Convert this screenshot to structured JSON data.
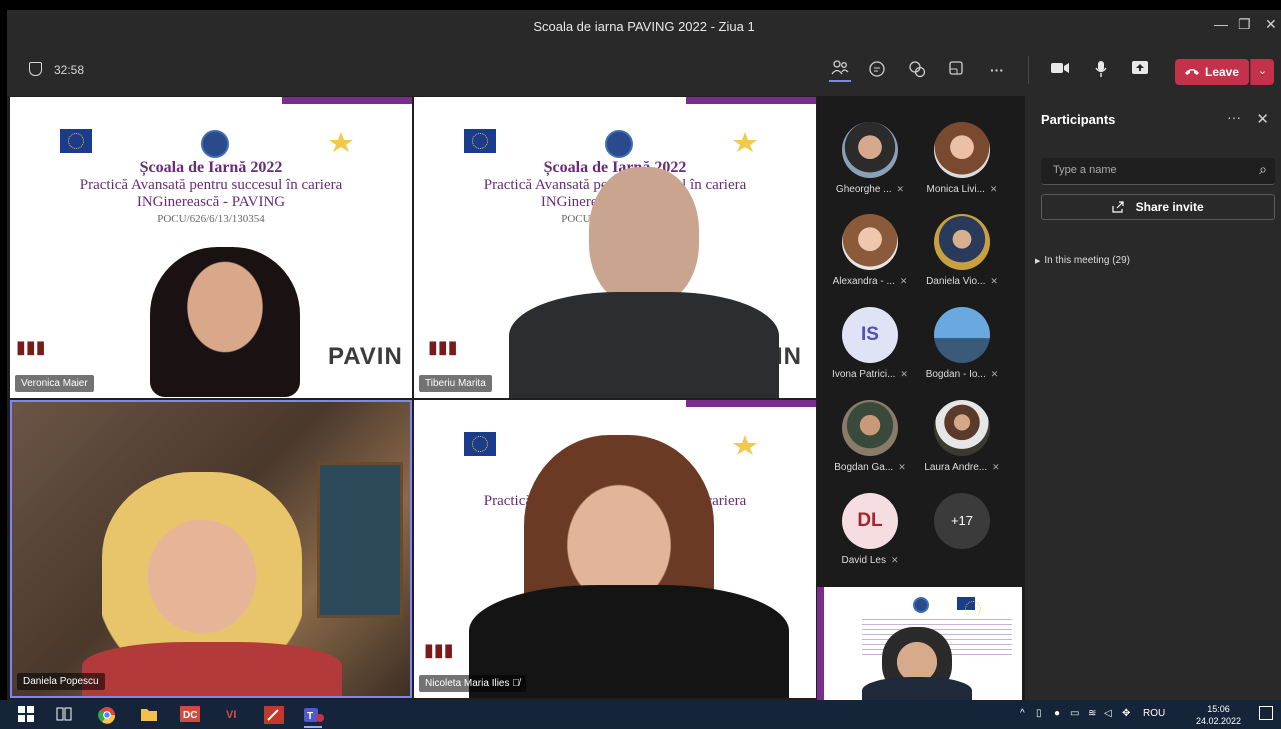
{
  "window": {
    "title": "Scoala de iarna PAVING 2022 - Ziua 1"
  },
  "toolbar": {
    "timer": "32:58",
    "leave_label": "Leave"
  },
  "slide": {
    "title": "Școala de Iarnă 2022",
    "line1": "Practică Avansată pentru succesul în cariera",
    "line2": "INGinerească - PAVING",
    "code": "POCU/626/6/13/130354",
    "paving": "PAVIN",
    "paving_cut": "VIN"
  },
  "tiles": [
    {
      "name": "Veronica Maier"
    },
    {
      "name": "Tiberiu Marita"
    },
    {
      "name": "Daniela Popescu"
    },
    {
      "name": "Nicoleta Maria Ilies"
    }
  ],
  "participants_grid": [
    {
      "name": "Gheorghe ...",
      "initials": ""
    },
    {
      "name": "Monica Livi...",
      "initials": ""
    },
    {
      "name": "Alexandra - ...",
      "initials": ""
    },
    {
      "name": "Daniela Vio...",
      "initials": ""
    },
    {
      "name": "Ivona Patrici...",
      "initials": "IS"
    },
    {
      "name": "Bogdan - Io...",
      "initials": ""
    },
    {
      "name": "Bogdan Ga...",
      "initials": ""
    },
    {
      "name": "Laura Andre...",
      "initials": ""
    },
    {
      "name": "David Les",
      "initials": "DL"
    }
  ],
  "overflow_count": "+17",
  "panel": {
    "title": "Participants",
    "search_placeholder": "Type a name",
    "share_invite": "Share invite",
    "meeting_section": "In this meeting (29)"
  },
  "taskbar": {
    "lang": "ROU",
    "time": "15:06",
    "date": "24.02.2022"
  },
  "colors": {
    "accent_purple": "#7b2d8e",
    "leave_red": "#c4314b",
    "teams_active": "#7f85f5"
  }
}
